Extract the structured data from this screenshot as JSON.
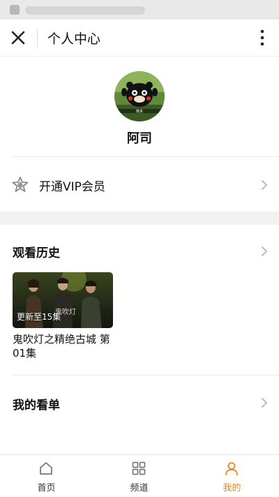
{
  "header": {
    "title": "个人中心"
  },
  "profile": {
    "username": "阿司",
    "avatar_caption": "熊本"
  },
  "vip": {
    "label": "开通VIP会员"
  },
  "history": {
    "title": "观看历史",
    "items": [
      {
        "badge": "更新至15集",
        "title": "鬼吹灯之精绝古城 第01集",
        "thumb_text": "鬼吹灯"
      }
    ]
  },
  "watchlist": {
    "title": "我的看单"
  },
  "nav": {
    "items": [
      {
        "label": "首页",
        "icon": "home-icon"
      },
      {
        "label": "频道",
        "icon": "grid-icon"
      },
      {
        "label": "我的",
        "icon": "user-icon",
        "active": true
      }
    ]
  },
  "colors": {
    "accent": "#f5821f",
    "icon_gray": "#777777",
    "chevron": "#bbbbbb",
    "section_gap": "#f2f2f2"
  }
}
